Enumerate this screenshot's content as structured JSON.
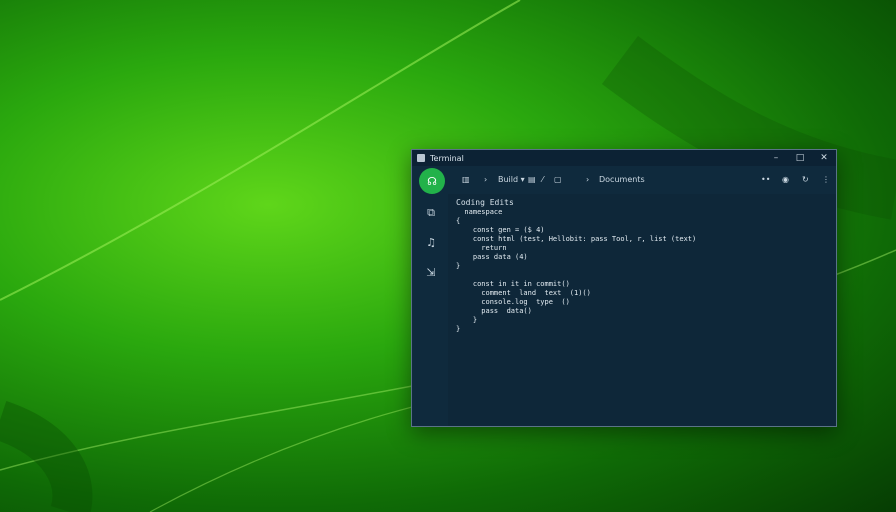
{
  "window": {
    "title": "Terminal",
    "controls": {
      "minimize": "–",
      "maximize": "□",
      "close": "✕"
    }
  },
  "toolbar": {
    "avatar_glyph": "☊",
    "menu_icon": "▥",
    "chevron1": "›",
    "build_label": "Build ▾",
    "icon_a": "▤",
    "icon_b": "⁄",
    "icon_c": "▢",
    "chevron2": "›",
    "location_label": "Documents",
    "more": "••",
    "debug_icon": "◉",
    "refresh_icon": "↻",
    "kebab": "⋮"
  },
  "sidebar": {
    "items": [
      {
        "icon": "⧉"
      },
      {
        "icon": "♫"
      },
      {
        "icon": "⇲"
      }
    ]
  },
  "editor": {
    "title": "Coding Edits",
    "lines": [
      "  namespace",
      "{",
      "    const gen = ($ 4)",
      "    const html (test, Hellobit: pass Tool, r, list (text)",
      "      return",
      "    pass data (4)",
      "}",
      "",
      "    const in it in commit()",
      "      comment  land  text  (1)()",
      "      console.log  type  ()",
      "      pass  data()",
      "    }",
      "}"
    ]
  },
  "colors": {
    "wallpaper_light": "#5fd61a",
    "wallpaper_dark": "#063d03",
    "window_bg": "#0f2a3d",
    "accent": "#22b24a"
  }
}
